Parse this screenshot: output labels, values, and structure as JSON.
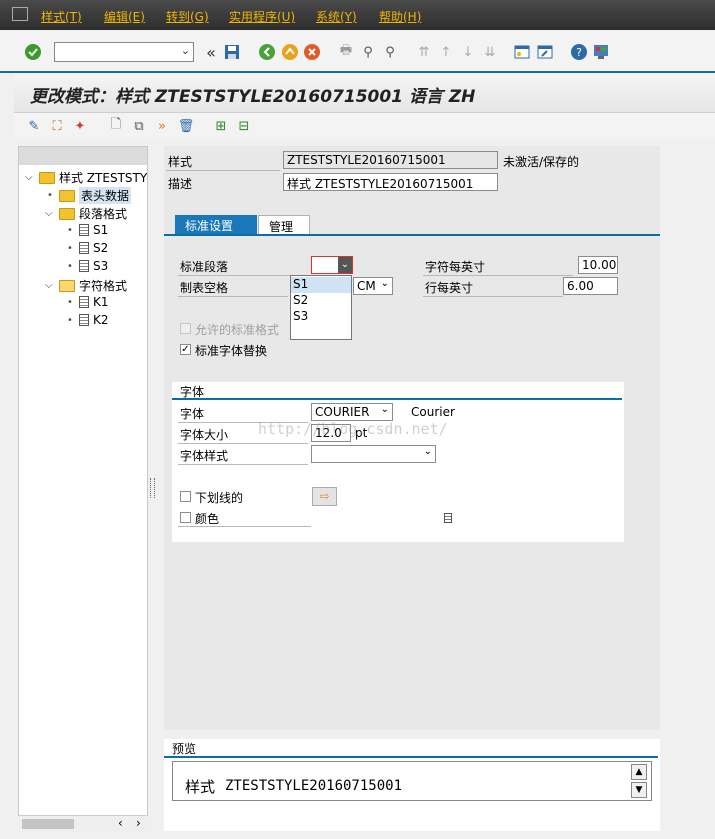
{
  "menu": [
    "样式(T)",
    "编辑(E)",
    "转到(G)",
    "实用程序(U)",
    "系统(Y)",
    "帮助(H)"
  ],
  "toolbar": {
    "nav_back": "«"
  },
  "title": "更改模式：样式 ZTESTSTYLE20160715001 语言 ZH",
  "tree": {
    "root": "样式 ZTESTSTY",
    "header_data": "表头数据",
    "paragraph_formats": "段落格式",
    "paragraphs": [
      "S1",
      "S2",
      "S3"
    ],
    "character_formats": "字符格式",
    "characters": [
      "K1",
      "K2"
    ]
  },
  "form": {
    "style_label": "样式",
    "style_value": "ZTESTSTYLE20160715001",
    "status": "未激活/保存的",
    "desc_label": "描述",
    "desc_value": "样式 ZTESTSTYLE20160715001"
  },
  "tabs": [
    "标准设置",
    "管理"
  ],
  "settings": {
    "std_para_label": "标准段落",
    "tab_space_label": "制表空格",
    "tab_unit": "CM",
    "cpi_label": "字符每英寸",
    "cpi_value": "10.00",
    "lpi_label": "行每英寸",
    "lpi_value": "6.00",
    "allowed_std_label": "允许的标准格式",
    "font_replace_label": "标准字体替换"
  },
  "dropdown_options": [
    "S1",
    "S2",
    "S3"
  ],
  "font": {
    "group_title": "字体",
    "font_label": "字体",
    "font_value": "COURIER",
    "font_name": "Courier",
    "size_label": "字体大小",
    "size_value": "12.0",
    "size_unit": "pt",
    "style_label": "字体样式",
    "underline_label": "下划线的",
    "color_label": "颜色"
  },
  "preview": {
    "title": "预览",
    "prefix": "样式",
    "text": "ZTESTSTYLE20160715001"
  },
  "watermark": "http://blog.csdn.net/"
}
